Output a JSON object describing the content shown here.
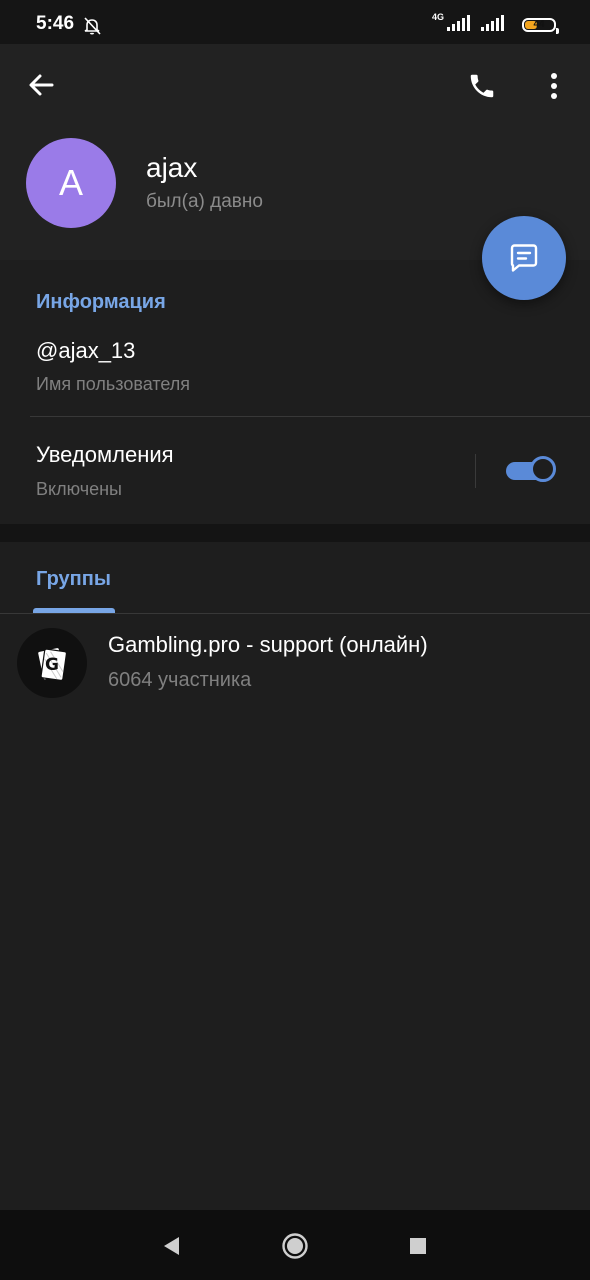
{
  "status_bar": {
    "time": "5:46",
    "network_type": "4G",
    "battery_level": "44",
    "battery_fraction": 0.44,
    "icons": [
      "bell-off-icon",
      "signal-icon",
      "signal-icon",
      "battery-icon"
    ]
  },
  "header": {
    "back_icon": "arrow-left-icon",
    "call_icon": "phone-icon",
    "more_icon": "more-vertical-icon",
    "avatar_letter": "A",
    "avatar_color": "#9a7be8",
    "name": "ajax",
    "last_seen": "был(а) давно",
    "fab_icon": "message-icon"
  },
  "info": {
    "section_title": "Информация",
    "username_value": "@ajax_13",
    "username_label": "Имя пользователя",
    "notifications_title": "Уведомления",
    "notifications_status": "Включены",
    "notifications_enabled": true
  },
  "groups": {
    "tab_label": "Группы",
    "items": [
      {
        "name": "Gambling.pro - support (онлайн)",
        "members": "6064 участника",
        "avatar_icon": "cards-logo-icon"
      }
    ]
  },
  "nav_bar": {
    "icons": [
      "nav-back-icon",
      "nav-home-icon",
      "nav-recent-icon"
    ]
  },
  "colors": {
    "accent": "#78a6e6",
    "fab": "#5a8ad8",
    "background": "#1a1a1a",
    "header_bg": "#222222",
    "battery_fill": "#f3a51f"
  }
}
